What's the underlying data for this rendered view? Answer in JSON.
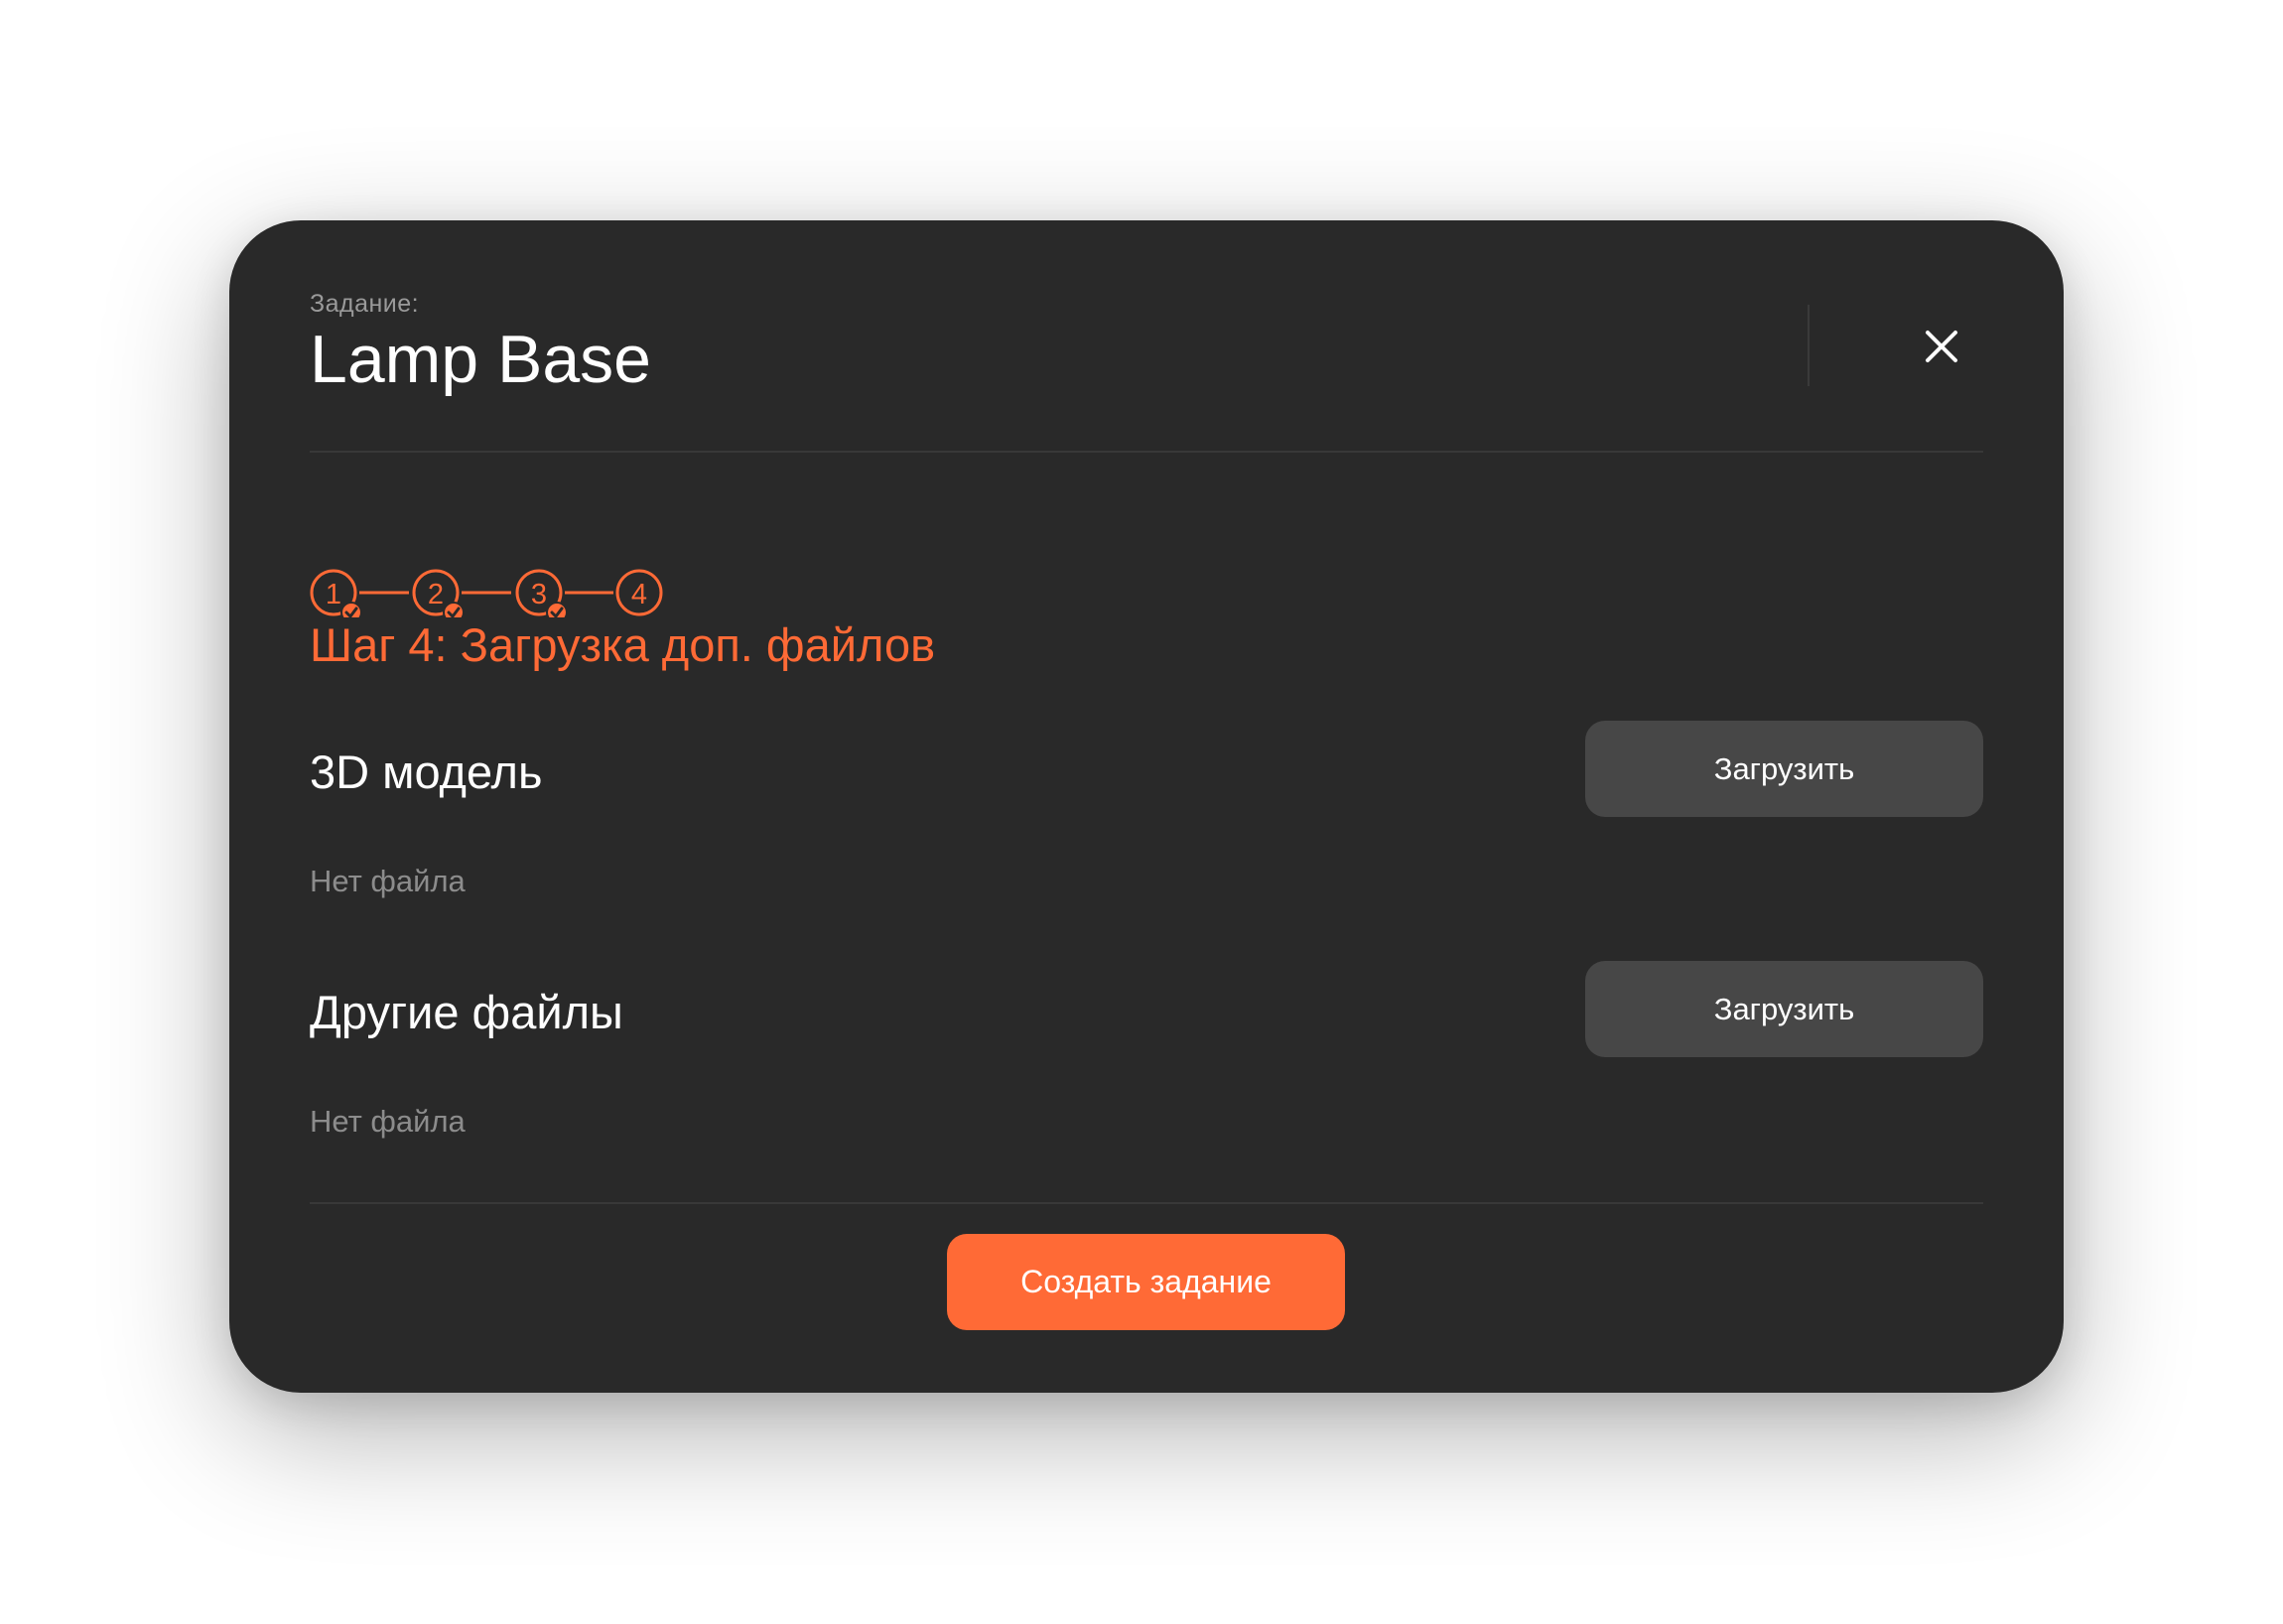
{
  "header": {
    "label": "Задание:",
    "title": "Lamp Base"
  },
  "stepper": {
    "steps": [
      {
        "number": "1",
        "completed": true
      },
      {
        "number": "2",
        "completed": true
      },
      {
        "number": "3",
        "completed": true
      },
      {
        "number": "4",
        "completed": false
      }
    ],
    "current_step_title": "Шаг 4: Загрузка доп. файлов"
  },
  "sections": [
    {
      "title": "3D модель",
      "status": "Нет файла",
      "button_label": "Загрузить"
    },
    {
      "title": "Другие файлы",
      "status": "Нет файла",
      "button_label": "Загрузить"
    }
  ],
  "footer": {
    "submit_label": "Создать задание"
  },
  "icons": {
    "close": "close-icon",
    "check": "check-icon"
  },
  "colors": {
    "accent": "#ff6a36",
    "modal_bg": "#292929",
    "button_bg": "#474747"
  }
}
